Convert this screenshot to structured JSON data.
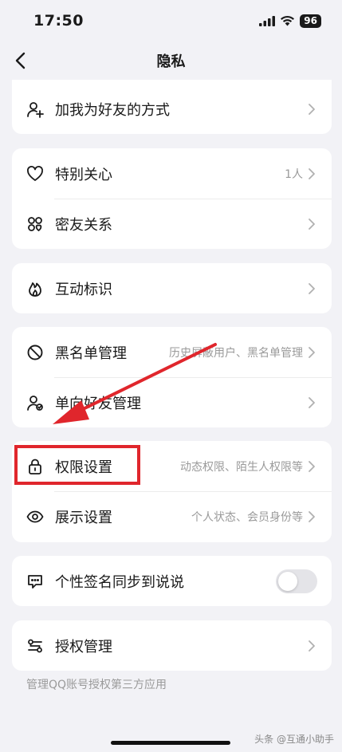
{
  "status_bar": {
    "time": "17:50",
    "battery": "96"
  },
  "nav": {
    "title": "隐私"
  },
  "groups": {
    "add_friend": {
      "label": "加我为好友的方式"
    },
    "special_care": {
      "label": "特别关心",
      "value": "1人"
    },
    "close_friend": {
      "label": "密友关系"
    },
    "interaction": {
      "label": "互动标识"
    },
    "blacklist": {
      "label": "黑名单管理",
      "value": "历史屏蔽用户、黑名单管理"
    },
    "one_way": {
      "label": "单向好友管理"
    },
    "permission": {
      "label": "权限设置",
      "value": "动态权限、陌生人权限等"
    },
    "display": {
      "label": "展示设置",
      "value": "个人状态、会员身份等"
    },
    "signature_sync": {
      "label": "个性签名同步到说说",
      "toggle_on": false
    },
    "auth": {
      "label": "授权管理"
    }
  },
  "footnote": "管理QQ账号授权第三方应用",
  "watermark": "头条 @互通小助手",
  "colors": {
    "highlight": "#e0262c",
    "background": "#f2f2f6"
  }
}
